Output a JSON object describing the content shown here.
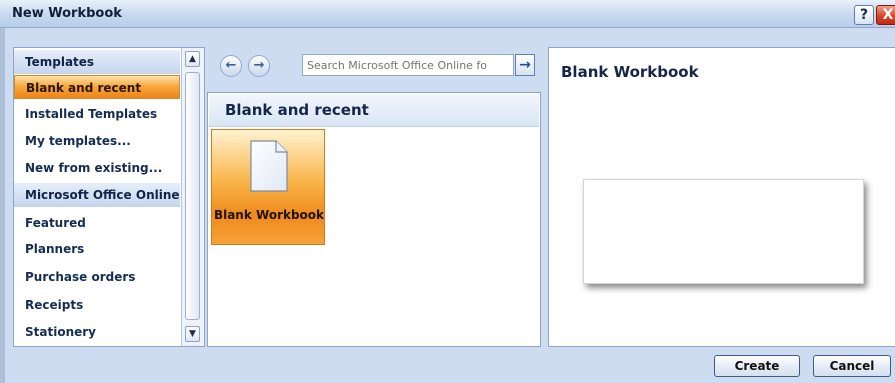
{
  "window": {
    "title": "New Workbook",
    "help_label": "?",
    "close_label": "X"
  },
  "sidebar": {
    "items": [
      {
        "label": "Templates",
        "kind": "header"
      },
      {
        "label": "Blank and recent",
        "kind": "selected"
      },
      {
        "label": "Installed Templates",
        "kind": "item"
      },
      {
        "label": "My templates...",
        "kind": "item"
      },
      {
        "label": "New from existing...",
        "kind": "item"
      },
      {
        "label": "Microsoft Office Online",
        "kind": "header"
      },
      {
        "label": "Featured",
        "kind": "item"
      },
      {
        "label": "Planners",
        "kind": "item"
      },
      {
        "label": "Purchase orders",
        "kind": "item"
      },
      {
        "label": "Receipts",
        "kind": "item"
      },
      {
        "label": "Stationery",
        "kind": "item"
      }
    ]
  },
  "toolbar": {
    "back_icon": "back-arrow-icon",
    "forward_icon": "forward-arrow-icon",
    "search_placeholder": "Search Microsoft Office Online fo",
    "go_icon": "go-arrow-icon"
  },
  "gallery": {
    "section_title": "Blank and recent",
    "tiles": [
      {
        "label": "Blank Workbook"
      }
    ]
  },
  "preview": {
    "title": "Blank Workbook"
  },
  "buttons": {
    "create": "Create",
    "cancel": "Cancel"
  },
  "colors": {
    "selection_orange": "#f7a43a",
    "frame_blue": "#cddcf0",
    "close_red": "#d9452a"
  }
}
